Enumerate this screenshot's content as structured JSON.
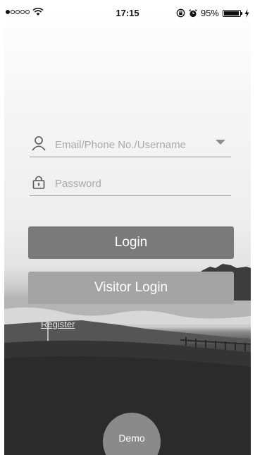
{
  "status_bar": {
    "time": "17:15",
    "battery_percent": "95%",
    "battery_level": 0.95
  },
  "login_form": {
    "username_placeholder": "Email/Phone No./Username",
    "password_placeholder": "Password"
  },
  "buttons": {
    "login_label": "Login",
    "visitor_login_label": "Visitor Login",
    "register_label": "Register",
    "demo_label": "Demo"
  },
  "colors": {
    "login_button": "#7a7a7a",
    "visitor_button": "#a4a4a4",
    "demo_button": "#8a8a8a",
    "placeholder_text": "#a9a9a9"
  },
  "icons": {
    "username": "user-icon",
    "password": "lock-icon",
    "dropdown": "chevron-down-icon",
    "wifi": "wifi-icon",
    "orientation_lock": "orientation-lock-icon",
    "alarm": "alarm-icon",
    "charging": "charging-icon"
  }
}
